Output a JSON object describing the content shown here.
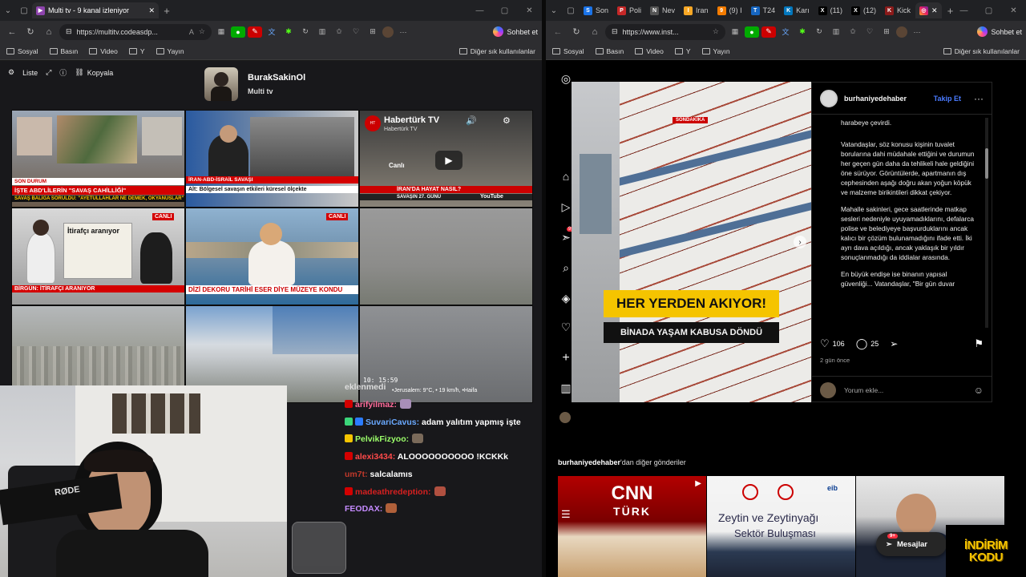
{
  "left_browser": {
    "tabs": [
      {
        "label": "Multi tv - 9 kanal izleniyor",
        "active": true
      }
    ],
    "url": "https://multitv.codeasdp...",
    "copilot_label": "Sohbet et",
    "bookmarks": [
      "Sosyal",
      "Basın",
      "Video",
      "Y",
      "Yayın"
    ],
    "bookmarks_right": "Diğer sık kullanılanlar"
  },
  "multitv": {
    "toolbar": {
      "list_label": "Liste",
      "copy_label": "Kopyala"
    },
    "channel": {
      "name": "BurakSakinOl",
      "sub": "Multi tv"
    },
    "cells": [
      {
        "banner1": "SON DURUM",
        "banner2": "İŞTE ABD'LİLERİN \"SAVAŞ CAHİLLİĞİ\"",
        "banner3": "SAVAŞ BALİĞA SORULDU: \"AYETULLAHLAR NE DEMEK, OKYANUSLAR\""
      },
      {
        "banner1": "İRAN-ABD-İSRAİL SAVAŞI",
        "banner2": "Alt: Bölgesel savaşın etkileri küresel ölçekte"
      },
      {
        "title": "Habertürk TV",
        "channel": "Habertürk TV",
        "live_label": "Canlı",
        "banner": "İRAN'DA HAYAT NASIL?",
        "sub": "SAVAŞIN 27. GÜNÜ",
        "yt": "YouTube"
      },
      {
        "banner1": "BİRGÜN: İTİRAFÇI ARANIYOR",
        "headline": "İtirafçı aranıyor",
        "live": "CANLI"
      },
      {
        "banner1": "DİZİ DEKORU TARİHİ ESER DİYE MÜZEYE KONDU",
        "live": "CANLI"
      },
      {},
      {},
      {},
      {
        "overlay": "10: 15:59",
        "weather": "•Jerusalem: 9°C, • 19 km/h, •Haifa"
      }
    ],
    "chat": [
      {
        "user": "eklenmedi",
        "msg": "",
        "user_color": "#dddddd"
      },
      {
        "user": "arifyilmaz:",
        "msg": "",
        "user_color": "#ff6b9a"
      },
      {
        "user": "SuvariCavus:",
        "msg": "adam yalıtım yapmış işte",
        "user_color": "#6aa9ff"
      },
      {
        "user": "PelvikFizyoo:",
        "msg": "",
        "user_color": "#9cff6a"
      },
      {
        "user": "alexi3434:",
        "msg": "ALOOOOOOOOOO !KCKKk",
        "user_color": "#ff4a4a"
      },
      {
        "user": "um7t:",
        "msg": "salcalamıs",
        "user_color": "#c0392b"
      },
      {
        "user": "madeathredeption:",
        "msg": "",
        "user_color": "#d62020"
      },
      {
        "user": "FEODAX:",
        "msg": "",
        "user_color": "#c58bff"
      }
    ],
    "cam_mic_label": "RØDE"
  },
  "right_browser": {
    "tabs": [
      {
        "label": "Son",
        "color": "#1a73e8",
        "glyph": "S"
      },
      {
        "label": "Poli",
        "color": "#c62828",
        "glyph": "P"
      },
      {
        "label": "Nev",
        "color": "#555555",
        "glyph": "N"
      },
      {
        "label": "Iran",
        "color": "#f9a825",
        "glyph": "I"
      },
      {
        "label": "(9) I",
        "color": "#f57c00",
        "glyph": "9"
      },
      {
        "label": "T24",
        "color": "#1565c0",
        "glyph": "T"
      },
      {
        "label": "Karı",
        "color": "#0277bd",
        "glyph": "K"
      },
      {
        "label": "(11)",
        "color": "#000000",
        "glyph": "X"
      },
      {
        "label": "(12)",
        "color": "#000000",
        "glyph": "X"
      },
      {
        "label": "Kick",
        "color": "#8b1a1a",
        "glyph": "K"
      }
    ],
    "url": "https://www.inst...",
    "copilot_label": "Sohbet et",
    "bookmarks": [
      "Sosyal",
      "Basın",
      "Video",
      "Y",
      "Yayın"
    ],
    "bookmarks_right": "Diğer sık kullanılanlar"
  },
  "instagram": {
    "notification_count": "9+",
    "post": {
      "username": "burhaniyedehaber",
      "follow_label": "Takip Et",
      "media_tag": "SONDAKİKA",
      "headline": "HER YERDEN AKIYOR!",
      "subheadline": "BİNADA YAŞAM KABUSA DÖNDÜ",
      "caption": [
        "harabeye çevirdi.",
        "Vatandaşlar, söz konusu kişinin tuvalet borularına dahi müdahale ettiğini ve durumun her geçen gün daha da tehlikeli hale geldiğini öne sürüyor. Görüntülerde, apartmanın dış cephesinden aşağı doğru akan yoğun köpük ve malzeme birikintileri dikkat çekiyor.",
        "Mahalle sakinleri, gece saatlerinde matkap sesleri nedeniyle uyuyamadıklarını, defalarca polise ve belediyeye başvurduklarını ancak kalıcı bir çözüm bulunamadığını ifade etti. İki ayrı dava açıldığı, ancak yaklaşık bir yıldır sonuçlanmadığı da iddialar arasında.",
        "En büyük endişe ise binanın yapısal güvenliği... Vatandaşlar, \"Bir gün duvar"
      ],
      "likes": "106",
      "comments": "25",
      "time_ago": "2 gün önce",
      "comment_placeholder": "Yorum ekle..."
    },
    "more_from": {
      "user": "burhaniyedehaber",
      "suffix": "'dan diğer gönderiler"
    },
    "thumbs": [
      {
        "title": "CNN",
        "sub": "TÜRK"
      },
      {
        "title": "Zeytin ve Zeytinyağı",
        "sub": "Sektör Buluşması",
        "logo": "eib"
      },
      {}
    ],
    "messages_label": "Mesajlar",
    "messages_badge": "9+"
  },
  "overlay": {
    "line1": "İNDİRİM",
    "line2": "KODU"
  },
  "colors": {
    "accent_ig": "#4a7bff",
    "kick_green": "#53fc18",
    "news_red": "#d40000"
  }
}
